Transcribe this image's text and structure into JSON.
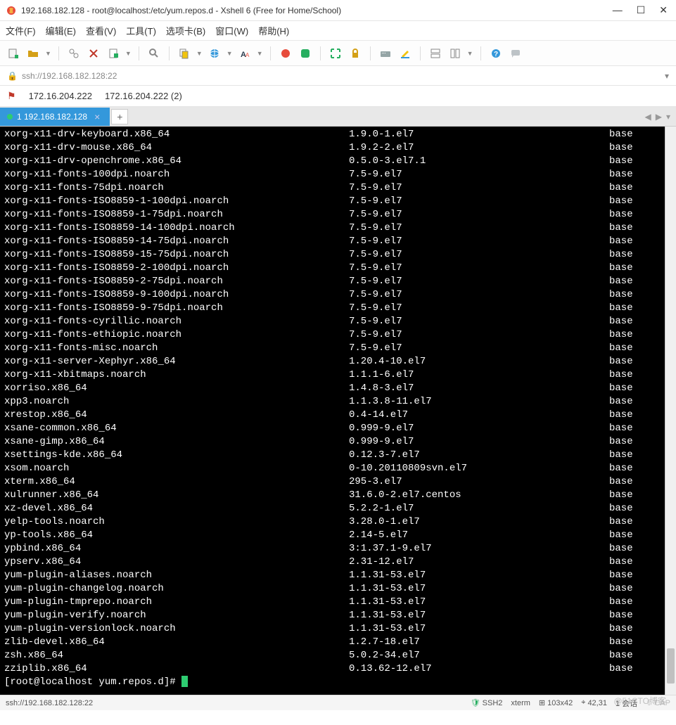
{
  "window": {
    "title": "192.168.182.128 - root@localhost:/etc/yum.repos.d - Xshell 6 (Free for Home/School)"
  },
  "menu": [
    "文件(F)",
    "编辑(E)",
    "查看(V)",
    "工具(T)",
    "选项卡(B)",
    "窗口(W)",
    "帮助(H)"
  ],
  "address": "ssh://192.168.182.128:22",
  "connections": {
    "flag": "⚑",
    "items": [
      "172.16.204.222",
      "172.16.204.222 (2)"
    ]
  },
  "tab": {
    "label": "1 192.168.182.128"
  },
  "terminal": {
    "rows": [
      [
        "xorg-x11-drv-keyboard.x86_64",
        "1.9.0-1.el7",
        "base"
      ],
      [
        "xorg-x11-drv-mouse.x86_64",
        "1.9.2-2.el7",
        "base"
      ],
      [
        "xorg-x11-drv-openchrome.x86_64",
        "0.5.0-3.el7.1",
        "base"
      ],
      [
        "xorg-x11-fonts-100dpi.noarch",
        "7.5-9.el7",
        "base"
      ],
      [
        "xorg-x11-fonts-75dpi.noarch",
        "7.5-9.el7",
        "base"
      ],
      [
        "xorg-x11-fonts-ISO8859-1-100dpi.noarch",
        "7.5-9.el7",
        "base"
      ],
      [
        "xorg-x11-fonts-ISO8859-1-75dpi.noarch",
        "7.5-9.el7",
        "base"
      ],
      [
        "xorg-x11-fonts-ISO8859-14-100dpi.noarch",
        "7.5-9.el7",
        "base"
      ],
      [
        "xorg-x11-fonts-ISO8859-14-75dpi.noarch",
        "7.5-9.el7",
        "base"
      ],
      [
        "xorg-x11-fonts-ISO8859-15-75dpi.noarch",
        "7.5-9.el7",
        "base"
      ],
      [
        "xorg-x11-fonts-ISO8859-2-100dpi.noarch",
        "7.5-9.el7",
        "base"
      ],
      [
        "xorg-x11-fonts-ISO8859-2-75dpi.noarch",
        "7.5-9.el7",
        "base"
      ],
      [
        "xorg-x11-fonts-ISO8859-9-100dpi.noarch",
        "7.5-9.el7",
        "base"
      ],
      [
        "xorg-x11-fonts-ISO8859-9-75dpi.noarch",
        "7.5-9.el7",
        "base"
      ],
      [
        "xorg-x11-fonts-cyrillic.noarch",
        "7.5-9.el7",
        "base"
      ],
      [
        "xorg-x11-fonts-ethiopic.noarch",
        "7.5-9.el7",
        "base"
      ],
      [
        "xorg-x11-fonts-misc.noarch",
        "7.5-9.el7",
        "base"
      ],
      [
        "xorg-x11-server-Xephyr.x86_64",
        "1.20.4-10.el7",
        "base"
      ],
      [
        "xorg-x11-xbitmaps.noarch",
        "1.1.1-6.el7",
        "base"
      ],
      [
        "xorriso.x86_64",
        "1.4.8-3.el7",
        "base"
      ],
      [
        "xpp3.noarch",
        "1.1.3.8-11.el7",
        "base"
      ],
      [
        "xrestop.x86_64",
        "0.4-14.el7",
        "base"
      ],
      [
        "xsane-common.x86_64",
        "0.999-9.el7",
        "base"
      ],
      [
        "xsane-gimp.x86_64",
        "0.999-9.el7",
        "base"
      ],
      [
        "xsettings-kde.x86_64",
        "0.12.3-7.el7",
        "base"
      ],
      [
        "xsom.noarch",
        "0-10.20110809svn.el7",
        "base"
      ],
      [
        "xterm.x86_64",
        "295-3.el7",
        "base"
      ],
      [
        "xulrunner.x86_64",
        "31.6.0-2.el7.centos",
        "base"
      ],
      [
        "xz-devel.x86_64",
        "5.2.2-1.el7",
        "base"
      ],
      [
        "yelp-tools.noarch",
        "3.28.0-1.el7",
        "base"
      ],
      [
        "yp-tools.x86_64",
        "2.14-5.el7",
        "base"
      ],
      [
        "ypbind.x86_64",
        "3:1.37.1-9.el7",
        "base"
      ],
      [
        "ypserv.x86_64",
        "2.31-12.el7",
        "base"
      ],
      [
        "yum-plugin-aliases.noarch",
        "1.1.31-53.el7",
        "base"
      ],
      [
        "yum-plugin-changelog.noarch",
        "1.1.31-53.el7",
        "base"
      ],
      [
        "yum-plugin-tmprepo.noarch",
        "1.1.31-53.el7",
        "base"
      ],
      [
        "yum-plugin-verify.noarch",
        "1.1.31-53.el7",
        "base"
      ],
      [
        "yum-plugin-versionlock.noarch",
        "1.1.31-53.el7",
        "base"
      ],
      [
        "zlib-devel.x86_64",
        "1.2.7-18.el7",
        "base"
      ],
      [
        "zsh.x86_64",
        "5.0.2-34.el7",
        "base"
      ],
      [
        "zziplib.x86_64",
        "0.13.62-12.el7",
        "base"
      ]
    ],
    "prompt": "[root@localhost yum.repos.d]# "
  },
  "status": {
    "addr": "ssh://192.168.182.128:22",
    "proto": "SSH2",
    "termtype": "xterm",
    "size": "103x42",
    "pos": "42,31",
    "session": "1 会话",
    "cap": "CAP"
  },
  "watermark": "@51CTO博客"
}
